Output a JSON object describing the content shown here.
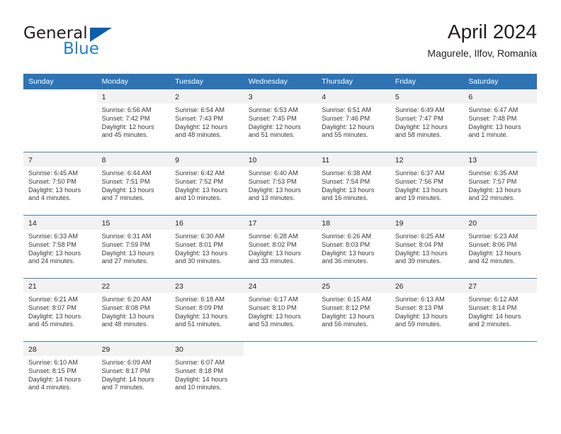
{
  "brand": {
    "name_part1": "General",
    "name_part2": "Blue"
  },
  "header": {
    "title": "April 2024",
    "subtitle": "Magurele, Ilfov, Romania"
  },
  "calendar": {
    "weekday_headers": [
      "Sunday",
      "Monday",
      "Tuesday",
      "Wednesday",
      "Thursday",
      "Friday",
      "Saturday"
    ],
    "colors": {
      "header_blue": "#2e74b5",
      "row_divider": "#4a7fb5",
      "daynum_band": "#f2f2f2",
      "brand_blue": "#2980c4",
      "logo_triangle": "#0b5faa"
    },
    "labels": {
      "sunrise_prefix": "Sunrise:",
      "sunset_prefix": "Sunset:",
      "daylight_prefix": "Daylight:"
    },
    "weeks": [
      [
        {
          "blank": true
        },
        {
          "day": "1",
          "sunrise": "Sunrise: 6:56 AM",
          "sunset": "Sunset: 7:42 PM",
          "daylight": "Daylight: 12 hours and 45 minutes."
        },
        {
          "day": "2",
          "sunrise": "Sunrise: 6:54 AM",
          "sunset": "Sunset: 7:43 PM",
          "daylight": "Daylight: 12 hours and 48 minutes."
        },
        {
          "day": "3",
          "sunrise": "Sunrise: 6:53 AM",
          "sunset": "Sunset: 7:45 PM",
          "daylight": "Daylight: 12 hours and 51 minutes."
        },
        {
          "day": "4",
          "sunrise": "Sunrise: 6:51 AM",
          "sunset": "Sunset: 7:46 PM",
          "daylight": "Daylight: 12 hours and 55 minutes."
        },
        {
          "day": "5",
          "sunrise": "Sunrise: 6:49 AM",
          "sunset": "Sunset: 7:47 PM",
          "daylight": "Daylight: 12 hours and 58 minutes."
        },
        {
          "day": "6",
          "sunrise": "Sunrise: 6:47 AM",
          "sunset": "Sunset: 7:48 PM",
          "daylight": "Daylight: 13 hours and 1 minute."
        }
      ],
      [
        {
          "day": "7",
          "sunrise": "Sunrise: 6:45 AM",
          "sunset": "Sunset: 7:50 PM",
          "daylight": "Daylight: 13 hours and 4 minutes."
        },
        {
          "day": "8",
          "sunrise": "Sunrise: 6:44 AM",
          "sunset": "Sunset: 7:51 PM",
          "daylight": "Daylight: 13 hours and 7 minutes."
        },
        {
          "day": "9",
          "sunrise": "Sunrise: 6:42 AM",
          "sunset": "Sunset: 7:52 PM",
          "daylight": "Daylight: 13 hours and 10 minutes."
        },
        {
          "day": "10",
          "sunrise": "Sunrise: 6:40 AM",
          "sunset": "Sunset: 7:53 PM",
          "daylight": "Daylight: 13 hours and 13 minutes."
        },
        {
          "day": "11",
          "sunrise": "Sunrise: 6:38 AM",
          "sunset": "Sunset: 7:54 PM",
          "daylight": "Daylight: 13 hours and 16 minutes."
        },
        {
          "day": "12",
          "sunrise": "Sunrise: 6:37 AM",
          "sunset": "Sunset: 7:56 PM",
          "daylight": "Daylight: 13 hours and 19 minutes."
        },
        {
          "day": "13",
          "sunrise": "Sunrise: 6:35 AM",
          "sunset": "Sunset: 7:57 PM",
          "daylight": "Daylight: 13 hours and 22 minutes."
        }
      ],
      [
        {
          "day": "14",
          "sunrise": "Sunrise: 6:33 AM",
          "sunset": "Sunset: 7:58 PM",
          "daylight": "Daylight: 13 hours and 24 minutes."
        },
        {
          "day": "15",
          "sunrise": "Sunrise: 6:31 AM",
          "sunset": "Sunset: 7:59 PM",
          "daylight": "Daylight: 13 hours and 27 minutes."
        },
        {
          "day": "16",
          "sunrise": "Sunrise: 6:30 AM",
          "sunset": "Sunset: 8:01 PM",
          "daylight": "Daylight: 13 hours and 30 minutes."
        },
        {
          "day": "17",
          "sunrise": "Sunrise: 6:28 AM",
          "sunset": "Sunset: 8:02 PM",
          "daylight": "Daylight: 13 hours and 33 minutes."
        },
        {
          "day": "18",
          "sunrise": "Sunrise: 6:26 AM",
          "sunset": "Sunset: 8:03 PM",
          "daylight": "Daylight: 13 hours and 36 minutes."
        },
        {
          "day": "19",
          "sunrise": "Sunrise: 6:25 AM",
          "sunset": "Sunset: 8:04 PM",
          "daylight": "Daylight: 13 hours and 39 minutes."
        },
        {
          "day": "20",
          "sunrise": "Sunrise: 6:23 AM",
          "sunset": "Sunset: 8:06 PM",
          "daylight": "Daylight: 13 hours and 42 minutes."
        }
      ],
      [
        {
          "day": "21",
          "sunrise": "Sunrise: 6:21 AM",
          "sunset": "Sunset: 8:07 PM",
          "daylight": "Daylight: 13 hours and 45 minutes."
        },
        {
          "day": "22",
          "sunrise": "Sunrise: 6:20 AM",
          "sunset": "Sunset: 8:08 PM",
          "daylight": "Daylight: 13 hours and 48 minutes."
        },
        {
          "day": "23",
          "sunrise": "Sunrise: 6:18 AM",
          "sunset": "Sunset: 8:09 PM",
          "daylight": "Daylight: 13 hours and 51 minutes."
        },
        {
          "day": "24",
          "sunrise": "Sunrise: 6:17 AM",
          "sunset": "Sunset: 8:10 PM",
          "daylight": "Daylight: 13 hours and 53 minutes."
        },
        {
          "day": "25",
          "sunrise": "Sunrise: 6:15 AM",
          "sunset": "Sunset: 8:12 PM",
          "daylight": "Daylight: 13 hours and 56 minutes."
        },
        {
          "day": "26",
          "sunrise": "Sunrise: 6:13 AM",
          "sunset": "Sunset: 8:13 PM",
          "daylight": "Daylight: 13 hours and 59 minutes."
        },
        {
          "day": "27",
          "sunrise": "Sunrise: 6:12 AM",
          "sunset": "Sunset: 8:14 PM",
          "daylight": "Daylight: 14 hours and 2 minutes."
        }
      ],
      [
        {
          "day": "28",
          "sunrise": "Sunrise: 6:10 AM",
          "sunset": "Sunset: 8:15 PM",
          "daylight": "Daylight: 14 hours and 4 minutes."
        },
        {
          "day": "29",
          "sunrise": "Sunrise: 6:09 AM",
          "sunset": "Sunset: 8:17 PM",
          "daylight": "Daylight: 14 hours and 7 minutes."
        },
        {
          "day": "30",
          "sunrise": "Sunrise: 6:07 AM",
          "sunset": "Sunset: 8:18 PM",
          "daylight": "Daylight: 14 hours and 10 minutes."
        },
        {
          "blank": true
        },
        {
          "blank": true
        },
        {
          "blank": true
        },
        {
          "blank": true
        }
      ]
    ]
  }
}
